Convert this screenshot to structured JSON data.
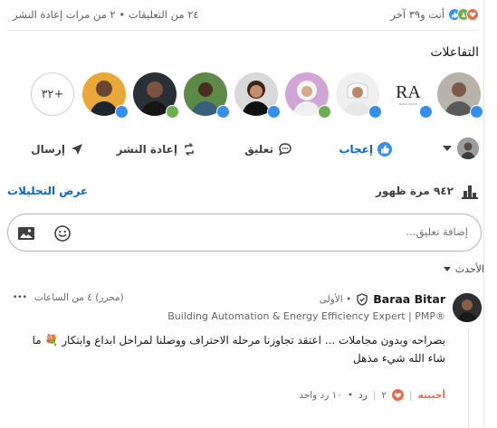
{
  "counts": {
    "reactors_text": "أنت و٣٩ آخر",
    "comments_reposts_text": "٢٤ من التعليقات • ٢ من مرات إعادة النشر"
  },
  "reactions": {
    "title": "التفاعلات",
    "more_count": "+٣٢",
    "avatars": [
      {
        "name": "reactor-1",
        "reaction": "like"
      },
      {
        "name": "reactor-2-ra-logo",
        "reaction": "like",
        "logo_text": "RA",
        "logo_sub": "RAAM GROUP"
      },
      {
        "name": "reactor-3",
        "reaction": "like"
      },
      {
        "name": "reactor-4",
        "reaction": "celebrate"
      },
      {
        "name": "reactor-5",
        "reaction": "like"
      },
      {
        "name": "reactor-6",
        "reaction": "like"
      },
      {
        "name": "reactor-7",
        "reaction": "like"
      },
      {
        "name": "reactor-8",
        "reaction": "celebrate"
      },
      {
        "name": "reactor-9",
        "reaction": "like"
      }
    ]
  },
  "actions": {
    "like": "إعجاب",
    "comment": "تعليق",
    "repost": "إعادة النشر",
    "send": "إرسال"
  },
  "analytics": {
    "impressions": "٩٤٢ مرة ظهور",
    "view_analytics": "عرض التحليلات"
  },
  "comment_input": {
    "placeholder": "إضافة تعليق..."
  },
  "sort": {
    "label": "الأحدث"
  },
  "comment": {
    "author": "Baraa Bitar",
    "degree": "• الأولى",
    "edited": "(محرر) ٤ من الساعات",
    "more": "•••",
    "headline": "Building Automation & Energy Efficiency Expert | PMP®",
    "body_line1": "بصراحه وبدون مجاملات ... اعتقد تجاوزنا مرحله الاحتراف ووصلنا لمراحل ابداع وابتكار 💐 ما",
    "body_line2": "شاء الله شيء مذهل",
    "like_action": "أحببته",
    "like_count": "٢",
    "reply_action": "رد",
    "reply_count": "١٠ رد واحد"
  },
  "colors": {
    "linkedin_blue": "#0a66c2",
    "like_blue": "#378fe9",
    "celebrate_green": "#6dae4f",
    "love_red": "#df704d"
  }
}
